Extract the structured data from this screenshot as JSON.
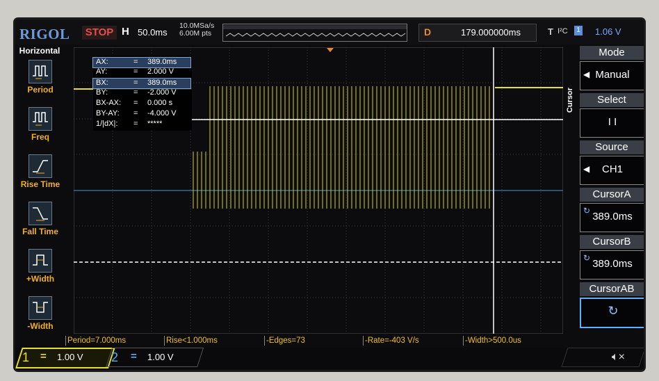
{
  "topbar": {
    "brand": "RIGOL",
    "run_state": "STOP",
    "horiz_label": "H",
    "timebase": "50.0ms",
    "sample_rate": "10.0MSa/s",
    "mem_depth": "6.00M pts",
    "delay_label": "D",
    "delay_value": "179.000000ms",
    "trigger_label": "T",
    "trigger_source": "I²C",
    "trigger_channel": "1",
    "trigger_level": "1.06 V"
  },
  "left_menu": {
    "title": "Horizontal",
    "items": [
      {
        "label": "Period",
        "icon": "period-icon"
      },
      {
        "label": "Freq",
        "icon": "freq-icon"
      },
      {
        "label": "Rise Time",
        "icon": "rise-time-icon"
      },
      {
        "label": "Fall Time",
        "icon": "fall-time-icon"
      },
      {
        "label": "+Width",
        "icon": "pos-width-icon"
      },
      {
        "label": "-Width",
        "icon": "neg-width-icon"
      }
    ]
  },
  "cursor_readout": [
    {
      "key": "AX:",
      "eq": "=",
      "value": "389.0ms",
      "highlight": true
    },
    {
      "key": "AY:",
      "eq": "=",
      "value": "2.000 V",
      "highlight": false
    },
    {
      "key": "BX:",
      "eq": "=",
      "value": "389.0ms",
      "highlight": true
    },
    {
      "key": "BY:",
      "eq": "=",
      "value": "-2.000 V",
      "highlight": false
    },
    {
      "key": "BX-AX:",
      "eq": "=",
      "value": "0.000 s",
      "highlight": false
    },
    {
      "key": "BY-AY:",
      "eq": "=",
      "value": "-4.000 V",
      "highlight": false
    },
    {
      "key": "1/|dX|:",
      "eq": "=",
      "value": "*****",
      "highlight": false
    }
  ],
  "right_menu": {
    "tab": "Cursor",
    "items": [
      {
        "title": "Mode",
        "value": "Manual",
        "control": "arrow"
      },
      {
        "title": "Select",
        "value": "I  I",
        "control": "none"
      },
      {
        "title": "Source",
        "value": "CH1",
        "control": "arrow"
      },
      {
        "title": "CursorA",
        "value": "389.0ms",
        "control": "refresh"
      },
      {
        "title": "CursorB",
        "value": "389.0ms",
        "control": "refresh"
      },
      {
        "title": "CursorAB",
        "value": "↻",
        "control": "highlight"
      }
    ]
  },
  "measurements": [
    "Period=7.000ms",
    "Rise<1.000ms",
    "-Edges=73",
    "-Rate=-403 V/s",
    "-Width>500.0us"
  ],
  "channels": [
    {
      "number": "1",
      "eq": "=",
      "scale": "1.00 V",
      "color": "#e8e02a"
    },
    {
      "number": "2",
      "eq": "=",
      "scale": "1.00 V",
      "color": "#5ab0e8"
    }
  ],
  "colors": {
    "ch1": "#e8e02a",
    "ch2": "#5ab0e8",
    "accent": "#e98a2c",
    "menu_blue": "#5b90d8"
  },
  "icons": {
    "speaker": "speaker-mute-icon"
  }
}
